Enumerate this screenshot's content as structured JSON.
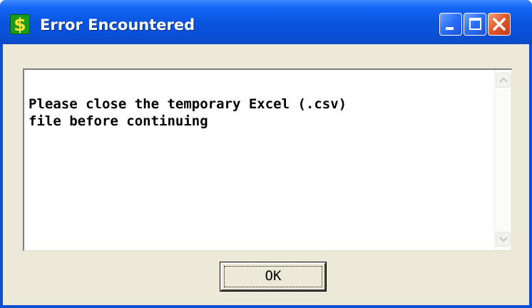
{
  "window": {
    "title": "Error Encountered",
    "app_icon_glyph": "$",
    "controls": {
      "minimize": "minimize-icon",
      "maximize": "maximize-icon",
      "close": "close-icon"
    }
  },
  "message": {
    "text": "Please close the temporary Excel (.csv)\nfile before continuing"
  },
  "buttons": {
    "ok_label": "OK"
  },
  "colors": {
    "titlebar": "#0a4fd6",
    "client_background": "#ece9d8",
    "close_button": "#e0562c"
  }
}
